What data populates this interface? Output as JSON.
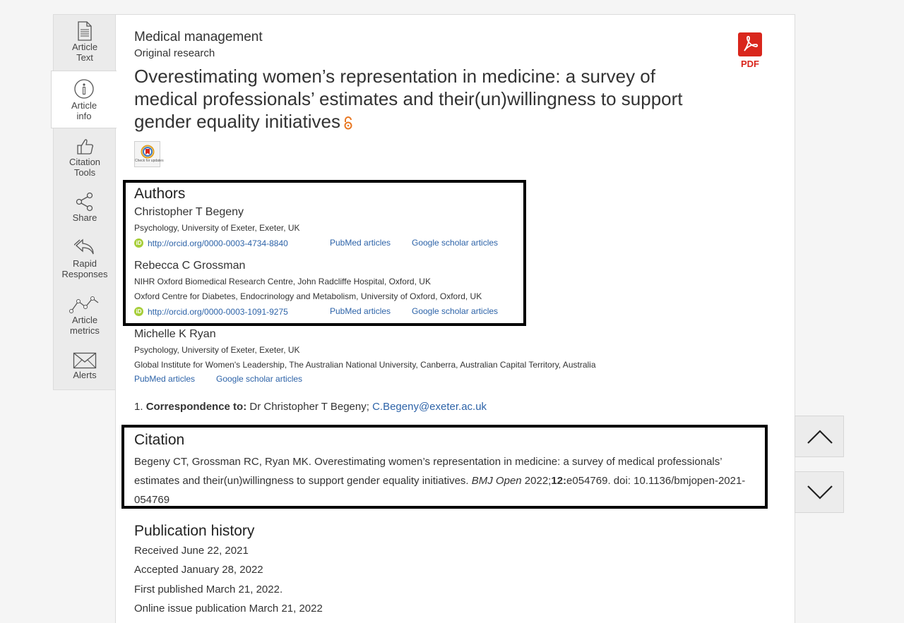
{
  "rail": {
    "items": [
      {
        "line1": "Article",
        "line2": "Text",
        "icon": "document-icon"
      },
      {
        "line1": "Article",
        "line2": "info",
        "icon": "info-icon"
      },
      {
        "line1": "Citation",
        "line2": "Tools",
        "icon": "thumbs-up-icon"
      },
      {
        "line1": "Share",
        "line2": "",
        "icon": "share-icon"
      },
      {
        "line1": "Rapid",
        "line2": "Responses",
        "icon": "reply-icon"
      },
      {
        "line1": "Article",
        "line2": "metrics",
        "icon": "metrics-icon"
      },
      {
        "line1": "Alerts",
        "line2": "",
        "icon": "envelope-icon"
      }
    ]
  },
  "article": {
    "subject": "Medical management",
    "type": "Original research",
    "title": "Overestimating women’s representation in medicine: a survey of medical professionals’ estimates and their(un)willingness to support gender equality initiatives",
    "pdf_label": "PDF",
    "check_updates": "Check for updates"
  },
  "authors": {
    "heading": "Authors",
    "list": [
      {
        "name": "Christopher T Begeny",
        "affiliations": [
          "Psychology, University of Exeter, Exeter, UK"
        ],
        "orcid": "http://orcid.org/0000-0003-4734-8840",
        "pubmed": "PubMed articles",
        "scholar": "Google scholar articles"
      },
      {
        "name": "Rebecca C Grossman",
        "affiliations": [
          "NIHR Oxford Biomedical Research Centre, John Radcliffe Hospital, Oxford, UK",
          "Oxford Centre for Diabetes, Endocrinology and Metabolism, University of Oxford, Oxford, UK"
        ],
        "orcid": "http://orcid.org/0000-0003-1091-9275",
        "pubmed": "PubMed articles",
        "scholar": "Google scholar articles"
      },
      {
        "name": "Michelle K Ryan",
        "affiliations": [
          "Psychology, University of Exeter, Exeter, UK",
          "Global Institute for Women's Leadership, The Australian National University, Canberra, Australian Capital Territory, Australia"
        ],
        "pubmed": "PubMed articles",
        "scholar": "Google scholar articles"
      }
    ]
  },
  "correspondence": {
    "number": "1.",
    "label": "Correspondence to:",
    "name": "Dr Christopher T Begeny;",
    "email": "C.Begeny@exeter.ac.uk"
  },
  "citation": {
    "heading": "Citation",
    "text_pre": "Begeny CT, Grossman RC, Ryan MK. Overestimating women’s representation in medicine: a survey of medical professionals’ estimates and their(un)willingness to support gender equality initiatives. ",
    "journal": "BMJ Open",
    "year": " 2022;",
    "volume": "12:",
    "text_post": "e054769. doi: 10.1136/bmjopen-2021-054769"
  },
  "history": {
    "heading": "Publication history",
    "items": [
      "Received June 22, 2021",
      "Accepted January 28, 2022",
      "First published March 21, 2022.",
      "Online issue publication March 21, 2022"
    ]
  },
  "colors": {
    "link": "#2d63a8",
    "pdf": "#d9261c",
    "orcid": "#a6ce39",
    "open_access": "#e87722"
  }
}
